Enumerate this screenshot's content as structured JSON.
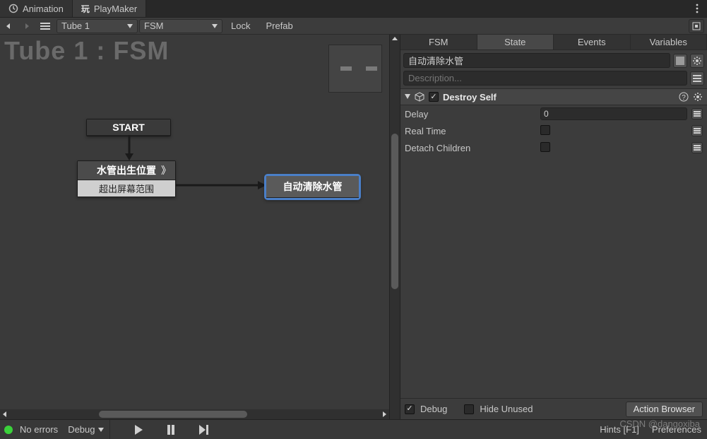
{
  "tabs": {
    "animation": "Animation",
    "playmaker": "PlayMaker"
  },
  "toolbar": {
    "object_dropdown": "Tube 1",
    "fsm_dropdown": "FSM",
    "lock": "Lock",
    "prefab": "Prefab"
  },
  "canvas": {
    "title": "Tube 1 : FSM",
    "start_label": "START",
    "spawn_header": "水管出生位置",
    "spawn_loop_marker": "》",
    "spawn_transition": "超出屏幕范围",
    "auto_clear": "自动清除水管"
  },
  "panel_tabs": {
    "fsm": "FSM",
    "state": "State",
    "events": "Events",
    "variables": "Variables"
  },
  "state": {
    "name": "自动清除水管",
    "description_placeholder": "Description..."
  },
  "action": {
    "name": "Destroy Self",
    "delay_label": "Delay",
    "delay_value": "0",
    "realtime_label": "Real Time",
    "detach_label": "Detach Children"
  },
  "footer": {
    "debug": "Debug",
    "hide_unused": "Hide Unused",
    "action_browser": "Action Browser"
  },
  "status": {
    "no_errors": "No errors",
    "debug": "Debug",
    "hints": "Hints [F1]",
    "preferences": "Preferences"
  },
  "watermark": "CSDN @dangoxiba"
}
